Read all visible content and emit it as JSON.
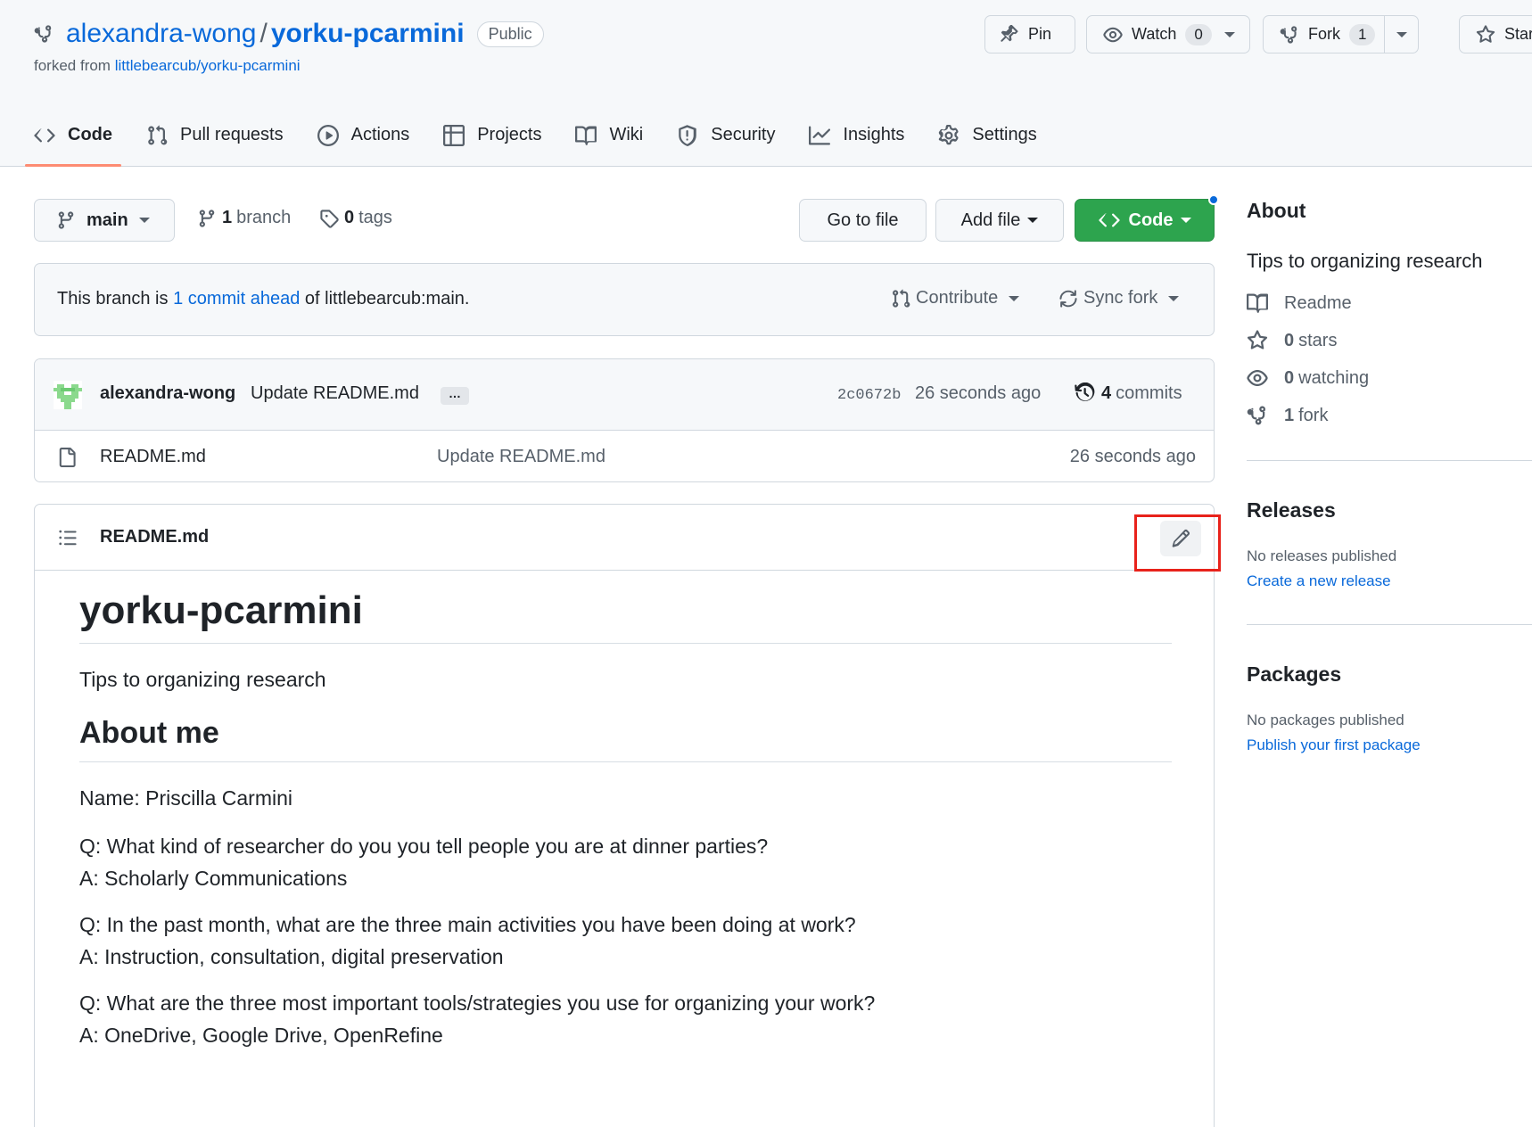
{
  "repo": {
    "owner": "alexandra-wong",
    "separator": "/",
    "name": "yorku-pcarmini",
    "visibility": "Public",
    "forked_from_prefix": "forked from ",
    "forked_from": "littlebearcub/yorku-pcarmini"
  },
  "header_actions": {
    "pin_label": "Pin",
    "watch_label": "Watch",
    "watch_count": "0",
    "fork_label": "Fork",
    "fork_count": "1",
    "star_label": "Star"
  },
  "nav": {
    "tabs": [
      {
        "label": "Code",
        "icon": "code-icon",
        "active": true
      },
      {
        "label": "Pull requests",
        "icon": "git-pull-request-icon"
      },
      {
        "label": "Actions",
        "icon": "play-icon"
      },
      {
        "label": "Projects",
        "icon": "table-icon"
      },
      {
        "label": "Wiki",
        "icon": "book-icon"
      },
      {
        "label": "Security",
        "icon": "shield-icon"
      },
      {
        "label": "Insights",
        "icon": "graph-icon"
      },
      {
        "label": "Settings",
        "icon": "gear-icon"
      }
    ]
  },
  "toolbar": {
    "branch": "main",
    "branch_count": "1",
    "branch_word": "branch",
    "tag_count": "0",
    "tag_word": "tags",
    "go_to_file": "Go to file",
    "add_file": "Add file",
    "code": "Code"
  },
  "ahead": {
    "prefix": "This branch is ",
    "link": "1 commit ahead",
    "suffix": " of littlebearcub:main.",
    "contribute": "Contribute",
    "sync_fork": "Sync fork"
  },
  "latest_commit": {
    "author": "alexandra-wong",
    "message": "Update README.md",
    "ellipsis": "…",
    "sha": "2c0672b",
    "time": "26 seconds ago",
    "commit_count": "4",
    "commit_word": "commits"
  },
  "files": [
    {
      "name": "README.md",
      "message": "Update README.md",
      "time": "26 seconds ago"
    }
  ],
  "readme": {
    "title": "README.md",
    "h1": "yorku-pcarmini",
    "intro": "Tips to organizing research",
    "h2": "About me",
    "name_line": "Name: Priscilla Carmini",
    "qa": [
      {
        "q": "Q: What kind of researcher do you you tell people you are at dinner parties?",
        "a": "A: Scholarly Communications"
      },
      {
        "q": "Q: In the past month, what are the three main activities you have been doing at work?",
        "a": "A: Instruction, consultation, digital preservation"
      },
      {
        "q": "Q: What are the three most important tools/strategies you use for organizing your work?",
        "a": "A: OneDrive, Google Drive, OpenRefine"
      }
    ]
  },
  "sidebar": {
    "about_title": "About",
    "description": "Tips to organizing research",
    "readme": "Readme",
    "stars_count": "0",
    "stars_word": "stars",
    "watching_count": "0",
    "watching_word": "watching",
    "forks_count": "1",
    "forks_word": "fork",
    "releases_title": "Releases",
    "releases_empty": "No releases published",
    "releases_link": "Create a new release",
    "packages_title": "Packages",
    "packages_empty": "No packages published",
    "packages_link": "Publish your first package"
  },
  "colors": {
    "accent": "#0969da",
    "primary_button": "#2da44e",
    "active_tab_underline": "#fd8c73",
    "annotation_highlight": "#e8221b"
  }
}
